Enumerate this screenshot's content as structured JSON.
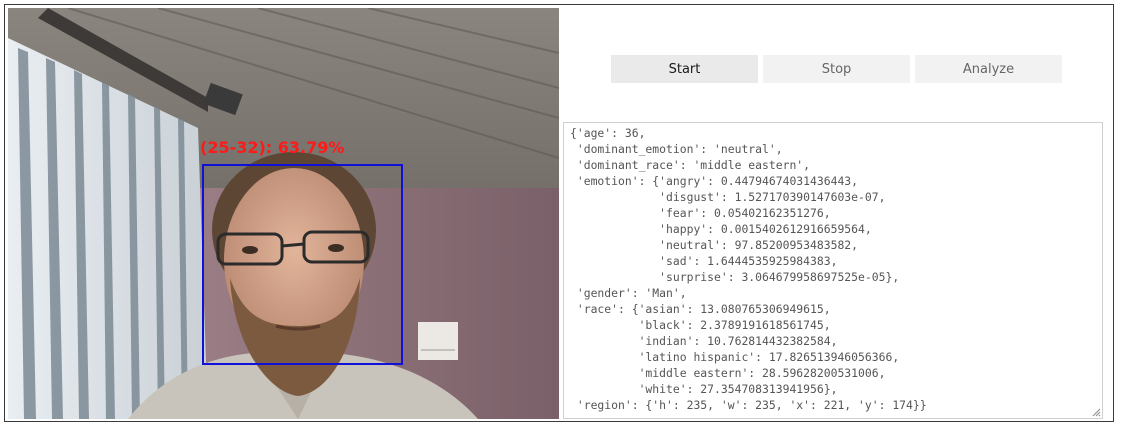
{
  "video": {
    "face_label": "(25-32): 63.79%"
  },
  "controls": {
    "start_label": "Start",
    "stop_label": "Stop",
    "analyze_label": "Analyze"
  },
  "result": {
    "lines": [
      "{'age': 36,",
      " 'dominant_emotion': 'neutral',",
      " 'dominant_race': 'middle eastern',",
      " 'emotion': {'angry': 0.44794674031436443,",
      "             'disgust': 1.527170390147603e-07,",
      "             'fear': 0.05402162351276,",
      "             'happy': 0.0015402612916659564,",
      "             'neutral': 97.85200953483582,",
      "             'sad': 1.6444535925984383,",
      "             'surprise': 3.064679958697525e-05},",
      " 'gender': 'Man',",
      " 'race': {'asian': 13.080765306949615,",
      "          'black': 2.3789191618561745,",
      "          'indian': 10.762814432382584,",
      "          'latino hispanic': 17.826513946056366,",
      "          'middle eastern': 28.59628200531006,",
      "          'white': 27.354708313941956},",
      " 'region': {'h': 235, 'w': 235, 'x': 221, 'y': 174}}"
    ]
  },
  "colors": {
    "box": "#1010d8",
    "label": "#ff1a1a"
  }
}
